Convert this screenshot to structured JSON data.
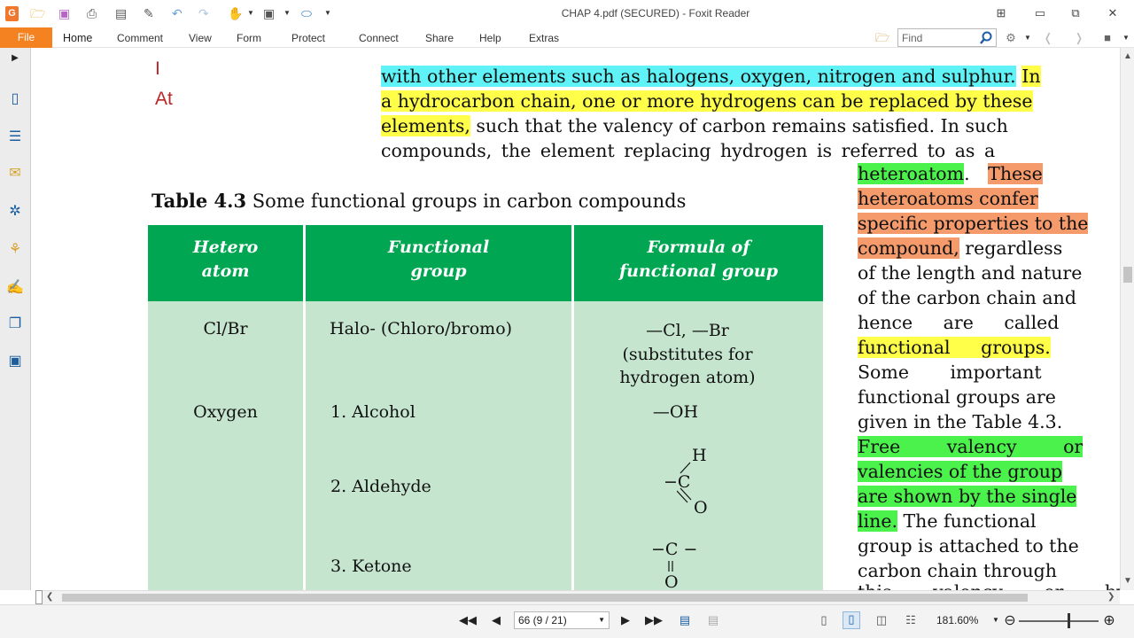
{
  "window": {
    "title": "CHAP 4.pdf (SECURED) - Foxit Reader"
  },
  "ribbon": {
    "file": "File",
    "tabs": [
      "Home",
      "Comment",
      "View",
      "Form",
      "Protect",
      "Connect",
      "Share",
      "Help",
      "Extras"
    ],
    "find_placeholder": "Find"
  },
  "document": {
    "margin_text": [
      "I",
      "At"
    ],
    "top_lines": [
      "with other elements such as halogens, oxygen, nitrogen and sulphur.",
      "In",
      "a hydrocarbon chain, one or more hydrogens can be replaced by these",
      "elements,",
      " such that the valency of carbon remains satisfied. In such",
      "compounds, the element replacing hydrogen is referred to as a"
    ],
    "side_lines": [
      [
        "heteroatom",
        ".  ",
        "These"
      ],
      [
        "heteroatoms confer"
      ],
      [
        "specific properties to the"
      ],
      [
        "compound,",
        " regardless"
      ],
      [
        "of the length and nature"
      ],
      [
        "of the carbon chain and"
      ],
      [
        "hence are called"
      ],
      [
        "functional groups."
      ],
      [
        "Some important"
      ],
      [
        "functional groups are"
      ],
      [
        "given in the Table 4.3."
      ],
      [
        "Free valency or"
      ],
      [
        "valencies of the group"
      ],
      [
        "are shown by the single"
      ],
      [
        "line.",
        " The functional"
      ],
      [
        "group is attached to the"
      ],
      [
        "carbon chain through"
      ],
      [
        "this valency or by"
      ]
    ],
    "table_caption_bold": "Table 4.3",
    "table_caption_rest": " Some functional groups in carbon compounds",
    "table": {
      "headers": [
        [
          "Hetero",
          "atom"
        ],
        [
          "Functional",
          "group"
        ],
        [
          "Formula of",
          "functional group"
        ]
      ],
      "rows": [
        {
          "atom": "Cl/Br",
          "group": "Halo- (Chloro/bromo)",
          "formula": [
            "—Cl, —Br",
            "(substitutes for",
            "hydrogen atom)"
          ]
        },
        {
          "atom": "Oxygen",
          "group": "1. Alcohol",
          "formula": [
            "—OH"
          ]
        },
        {
          "atom": "",
          "group": "2. Aldehyde",
          "formula": [
            "H",
            "C",
            "O"
          ]
        },
        {
          "atom": "",
          "group": "3. Ketone",
          "formula": [
            "C",
            "O"
          ]
        }
      ]
    }
  },
  "statusbar": {
    "page": "66 (9 / 21)",
    "zoom": "181.60%"
  },
  "colors": {
    "accent": "#f58220",
    "table_header": "#00a651",
    "table_body": "#c5e5cf",
    "highlight_cyan": "#5ff3f7",
    "highlight_yellow": "#ffff4a",
    "highlight_orange": "#f49a6b",
    "highlight_green": "#4cf24c"
  }
}
